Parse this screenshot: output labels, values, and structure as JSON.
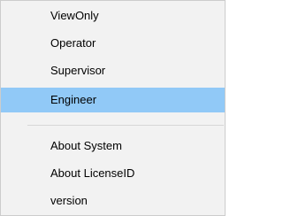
{
  "menu": {
    "items": [
      {
        "label": "ViewOnly"
      },
      {
        "label": "Operator"
      },
      {
        "label": "Supervisor"
      },
      {
        "label": "Engineer",
        "selected": true
      },
      {
        "label": "About System"
      },
      {
        "label": "About LicenseID"
      },
      {
        "label": "version"
      }
    ]
  },
  "colors": {
    "menu_background": "#f2f2f2",
    "selected_background": "#91c9f7",
    "separator": "#d7d7d7"
  }
}
